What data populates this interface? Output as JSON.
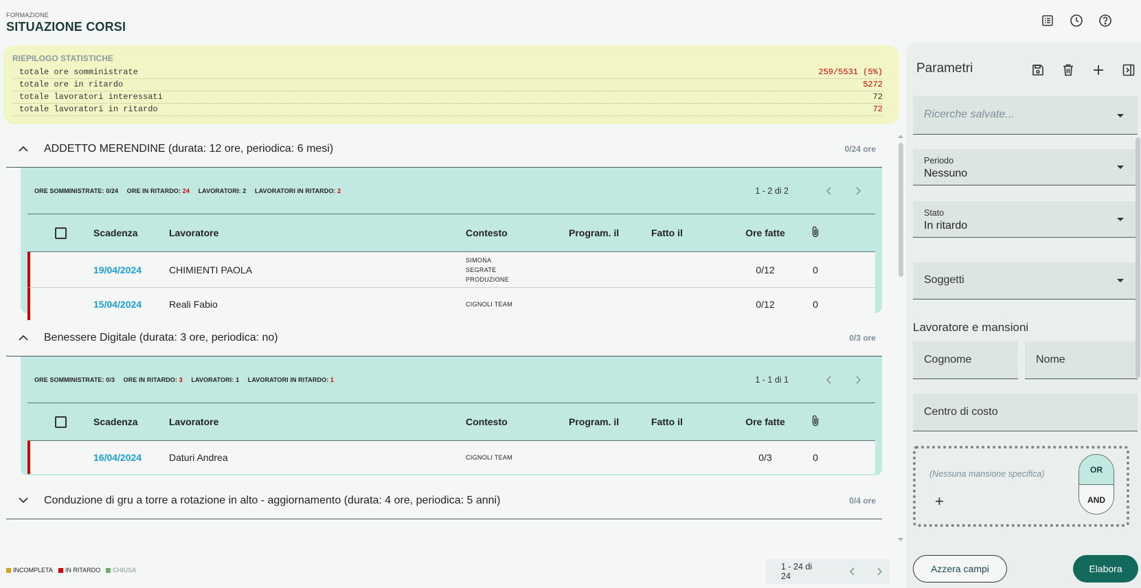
{
  "header": {
    "section": "FORMAZIONE",
    "title": "SITUAZIONE CORSI",
    "icons": [
      "list-icon",
      "history-icon",
      "help-icon"
    ]
  },
  "stats": {
    "title": "RIEPILOGO STATISTICHE",
    "rows": [
      {
        "label": "totale ore somministrate",
        "value": "259/5531 (5%)",
        "color": "#d10000"
      },
      {
        "label": "totale ore in ritardo",
        "value": "5272",
        "color": "#d10000"
      },
      {
        "label": "totale lavoratori interessati",
        "value": "72",
        "color": "#333333"
      },
      {
        "label": "totale lavoratori in ritardo",
        "value": "72",
        "color": "#d10000"
      }
    ]
  },
  "table_headers": {
    "scadenza": "Scadenza",
    "lavoratore": "Lavoratore",
    "contesto": "Contesto",
    "programmato": "Program. il",
    "fatto": "Fatto il",
    "ore": "Ore fatte"
  },
  "courses": [
    {
      "title": "ADDETTO MERENDINE (durata: 12 ore, periodica: 6 mesi)",
      "hours": "0/24 ore",
      "expanded": true,
      "stats": {
        "somm_label": "ORE SOMMINISTRATE:",
        "somm": "0/24",
        "rit_label": "ORE IN RITARDO:",
        "rit": "24",
        "lav_label": "LAVORATORI:",
        "lav": "2",
        "lavrit_label": "LAVORATORI IN RITARDO:",
        "lavrit": "2"
      },
      "pagination": "1 - 2 di 2",
      "rows": [
        {
          "scadenza": "19/04/2024",
          "lavoratore": "CHIMIENTI PAOLA",
          "contesto": [
            "SIMONA",
            "SEGRATE",
            "PRODUZIONE"
          ],
          "ore": "0/12",
          "allegati": "0"
        },
        {
          "scadenza": "15/04/2024",
          "lavoratore": "Reali Fabio",
          "contesto": [
            "CIGNOLI TEAM"
          ],
          "ore": "0/12",
          "allegati": "0"
        }
      ]
    },
    {
      "title": "Benessere Digitale (durata: 3 ore, periodica: no)",
      "hours": "0/3 ore",
      "expanded": true,
      "stats": {
        "somm_label": "ORE SOMMINISTRATE:",
        "somm": "0/3",
        "rit_label": "ORE IN RITARDO:",
        "rit": "3",
        "lav_label": "LAVORATORI:",
        "lav": "1",
        "lavrit_label": "LAVORATORI IN RITARDO:",
        "lavrit": "1"
      },
      "pagination": "1 - 1 di 1",
      "rows": [
        {
          "scadenza": "16/04/2024",
          "lavoratore": "Daturi Andrea",
          "contesto": [
            "CIGNOLI TEAM"
          ],
          "ore": "0/3",
          "allegati": "0"
        }
      ]
    },
    {
      "title": "Conduzione di gru a torre a rotazione in alto - aggiornamento (durata: 4 ore, periodica: 5 anni)",
      "hours": "0/4 ore",
      "expanded": false
    }
  ],
  "legend": [
    {
      "label": "INCOMPLETA",
      "color": "#d4a020"
    },
    {
      "label": "IN RITARDO",
      "color": "#d10000"
    },
    {
      "label": "CHIUSA",
      "color": "#6ab06a"
    }
  ],
  "footer_pagination": "1 - 24 di 24",
  "sidebar": {
    "title": "Parametri",
    "icons": [
      "save-icon",
      "delete-icon",
      "add-icon",
      "collapse-panel-icon"
    ],
    "saved_searches_placeholder": "Ricerche salvate...",
    "periodo": {
      "label": "Periodo",
      "value": "Nessuno"
    },
    "stato": {
      "label": "Stato",
      "value": "In ritardo"
    },
    "soggetti": "Soggetti",
    "section_title": "Lavoratore e mansioni",
    "cognome": "Cognome",
    "nome": "Nome",
    "centro_costo": "Centro di costo",
    "mansione_none": "(Nessuna mansione specifica)",
    "or_label": "OR",
    "and_label": "AND",
    "reset_label": "Azzera campi",
    "submit_label": "Elabora"
  }
}
